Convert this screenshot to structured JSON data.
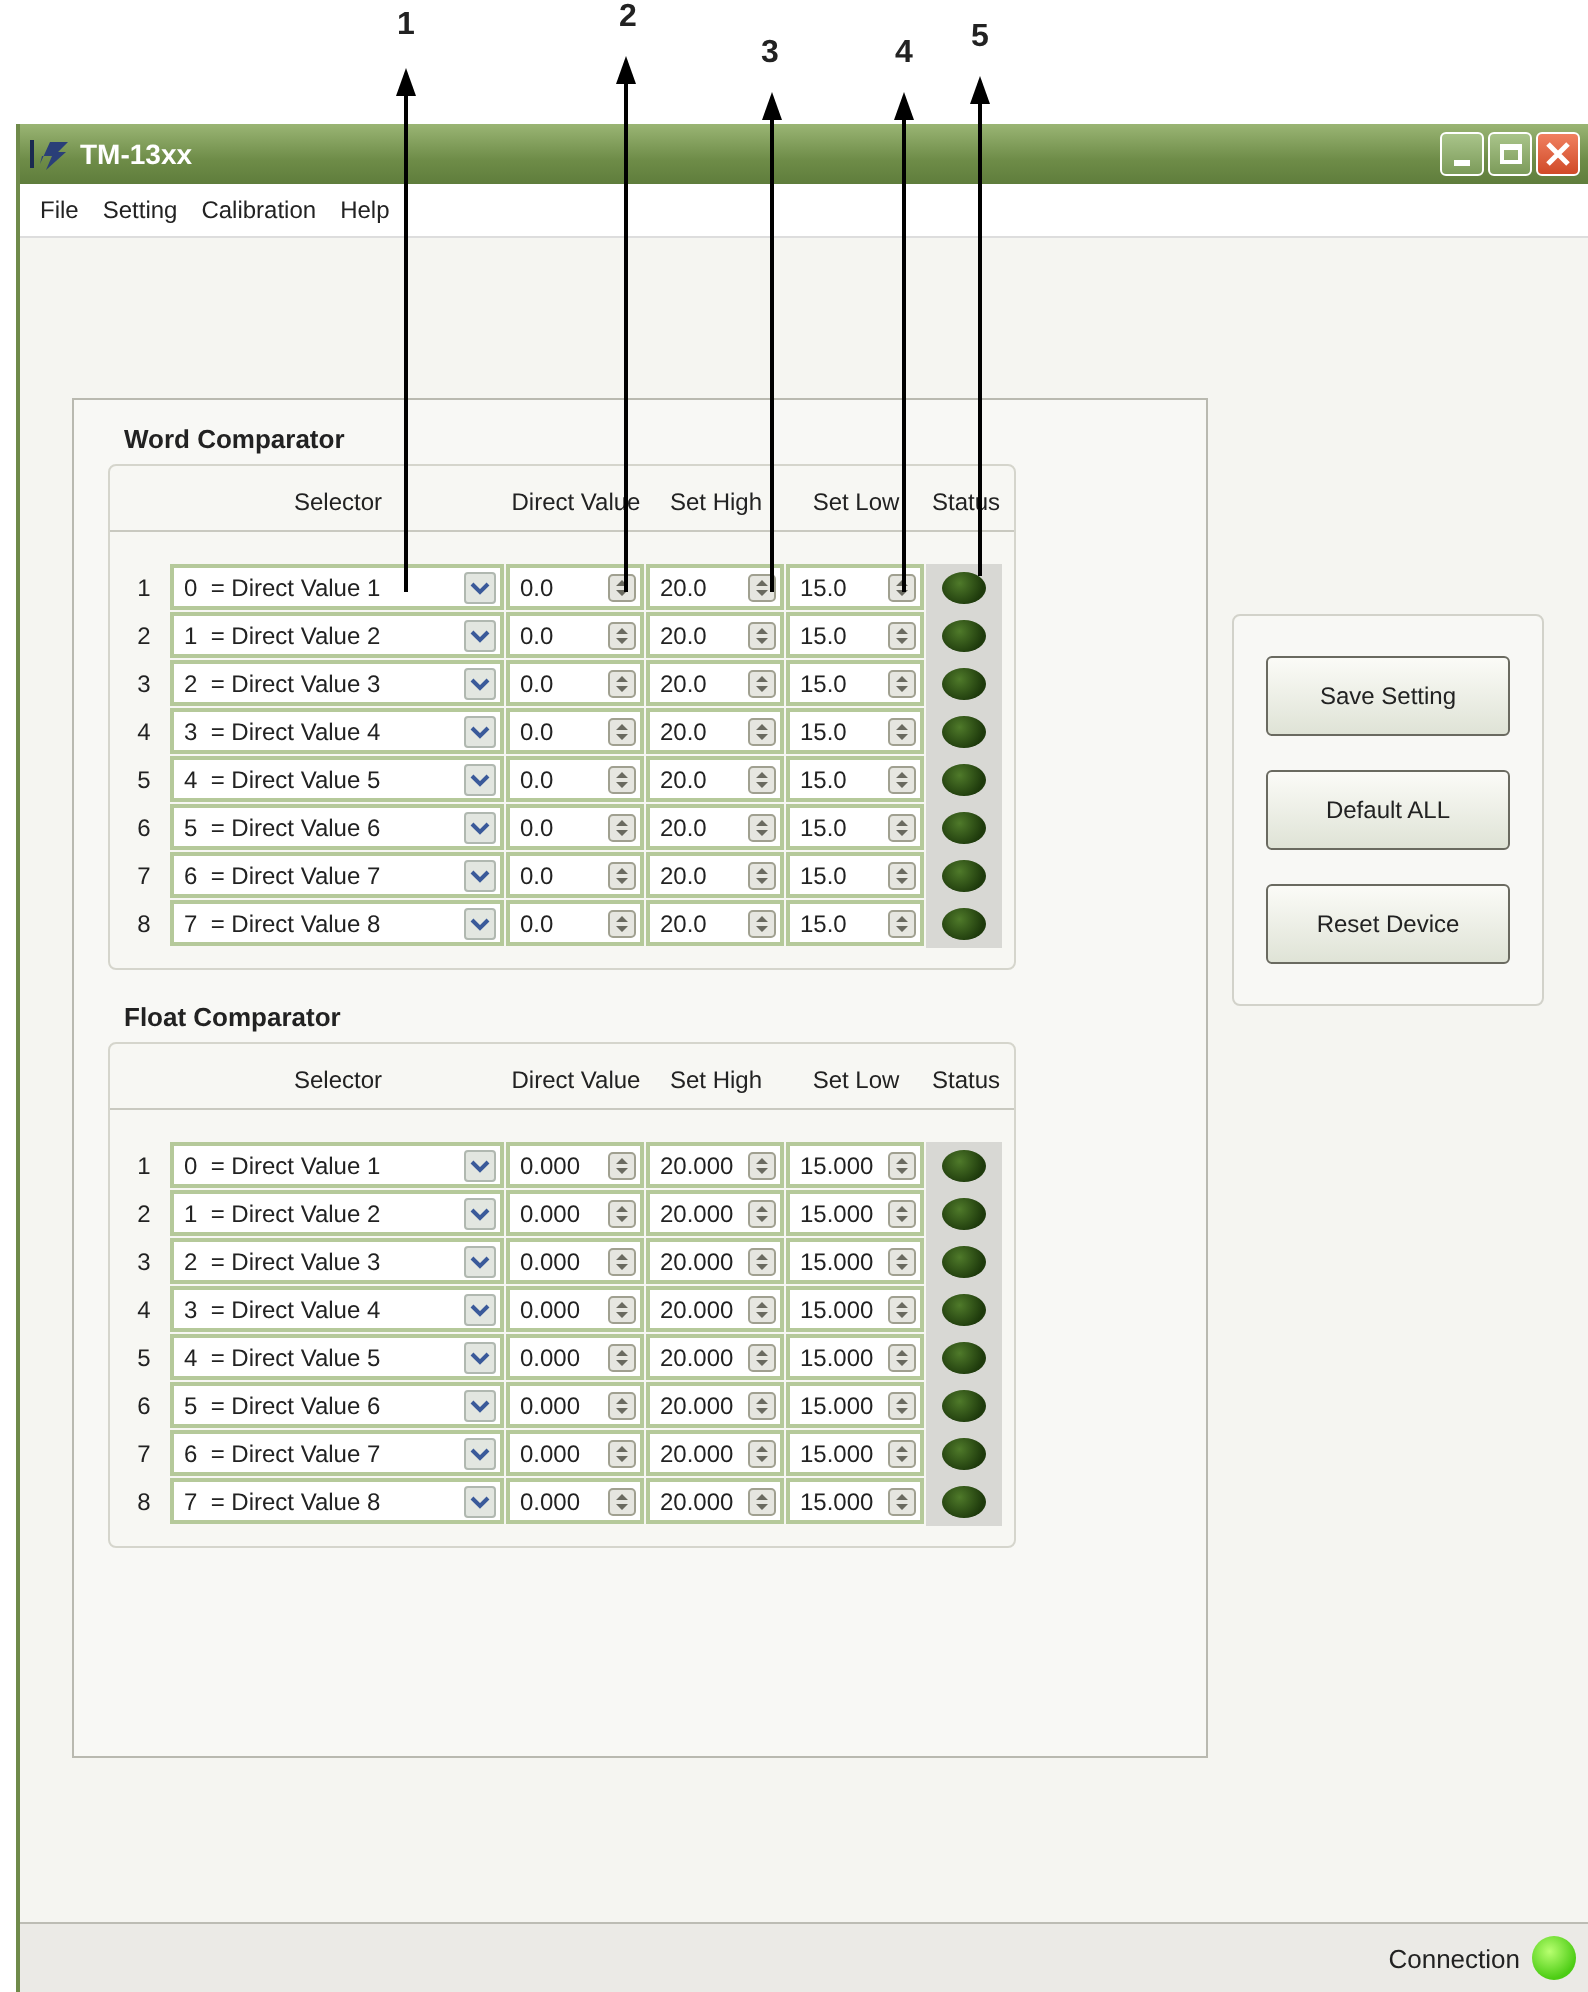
{
  "callouts": [
    {
      "label": "1"
    },
    {
      "label": "2"
    },
    {
      "label": "3"
    },
    {
      "label": "4"
    },
    {
      "label": "5"
    }
  ],
  "window": {
    "title": "TM-13xx"
  },
  "menu": [
    "File",
    "Setting",
    "Calibration",
    "Help"
  ],
  "comparators": [
    {
      "title": "Word Comparator",
      "columns": [
        "Selector",
        "Direct Value",
        "Set High",
        "Set Low",
        "Status"
      ],
      "rows": [
        {
          "index": "1",
          "selector": "0  = Direct Value 1",
          "direct_value": "0.0",
          "set_high": "20.0",
          "set_low": "15.0",
          "on": false
        },
        {
          "index": "2",
          "selector": "1  = Direct Value 2",
          "direct_value": "0.0",
          "set_high": "20.0",
          "set_low": "15.0",
          "on": false
        },
        {
          "index": "3",
          "selector": "2  = Direct Value 3",
          "direct_value": "0.0",
          "set_high": "20.0",
          "set_low": "15.0",
          "on": false
        },
        {
          "index": "4",
          "selector": "3  = Direct Value 4",
          "direct_value": "0.0",
          "set_high": "20.0",
          "set_low": "15.0",
          "on": false
        },
        {
          "index": "5",
          "selector": "4  = Direct Value 5",
          "direct_value": "0.0",
          "set_high": "20.0",
          "set_low": "15.0",
          "on": false
        },
        {
          "index": "6",
          "selector": "5  = Direct Value 6",
          "direct_value": "0.0",
          "set_high": "20.0",
          "set_low": "15.0",
          "on": false
        },
        {
          "index": "7",
          "selector": "6  = Direct Value 7",
          "direct_value": "0.0",
          "set_high": "20.0",
          "set_low": "15.0",
          "on": false
        },
        {
          "index": "8",
          "selector": "7  = Direct Value 8",
          "direct_value": "0.0",
          "set_high": "20.0",
          "set_low": "15.0",
          "on": false
        }
      ]
    },
    {
      "title": "Float Comparator",
      "columns": [
        "Selector",
        "Direct Value",
        "Set High",
        "Set Low",
        "Status"
      ],
      "rows": [
        {
          "index": "1",
          "selector": "0  = Direct Value 1",
          "direct_value": "0.000",
          "set_high": "20.000",
          "set_low": "15.000",
          "on": false
        },
        {
          "index": "2",
          "selector": "1  = Direct Value 2",
          "direct_value": "0.000",
          "set_high": "20.000",
          "set_low": "15.000",
          "on": false
        },
        {
          "index": "3",
          "selector": "2  = Direct Value 3",
          "direct_value": "0.000",
          "set_high": "20.000",
          "set_low": "15.000",
          "on": false
        },
        {
          "index": "4",
          "selector": "3  = Direct Value 4",
          "direct_value": "0.000",
          "set_high": "20.000",
          "set_low": "15.000",
          "on": false
        },
        {
          "index": "5",
          "selector": "4  = Direct Value 5",
          "direct_value": "0.000",
          "set_high": "20.000",
          "set_low": "15.000",
          "on": false
        },
        {
          "index": "6",
          "selector": "5  = Direct Value 6",
          "direct_value": "0.000",
          "set_high": "20.000",
          "set_low": "15.000",
          "on": false
        },
        {
          "index": "7",
          "selector": "6  = Direct Value 7",
          "direct_value": "0.000",
          "set_high": "20.000",
          "set_low": "15.000",
          "on": false
        },
        {
          "index": "8",
          "selector": "7  = Direct Value 8",
          "direct_value": "0.000",
          "set_high": "20.000",
          "set_low": "15.000",
          "on": false
        }
      ]
    }
  ],
  "buttons": [
    "Save Setting",
    "Default ALL",
    "Reset Device"
  ],
  "status_bar": {
    "label": "Connection",
    "connected": true
  }
}
